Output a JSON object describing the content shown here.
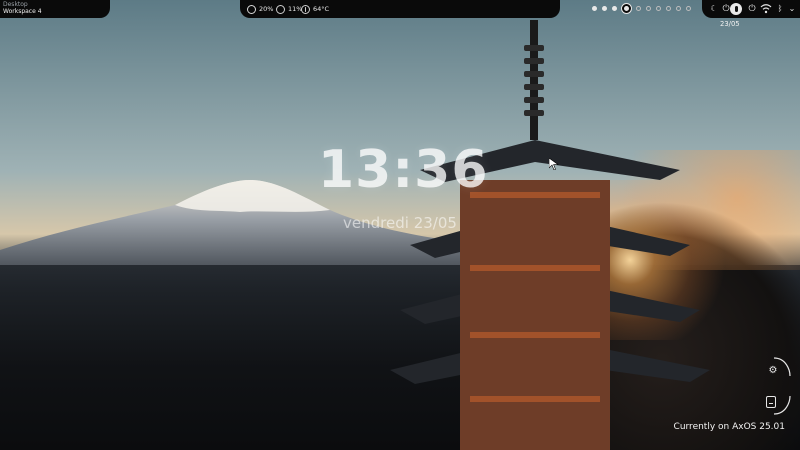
{
  "workspace_panel": {
    "label_top": "Desktop",
    "label_bottom": "Workspace 4"
  },
  "status": {
    "cpu": "20%",
    "memory": "11%",
    "temperature": "64°C"
  },
  "workspaces": {
    "count": 10,
    "active_index": 3,
    "filled_indices": [
      0,
      1,
      2
    ]
  },
  "topbar_clock": "13:36 • vendredi 23/05",
  "tray_icons": [
    "moon-icon",
    "power-icon",
    "toggle-icon",
    "power-button-icon",
    "wifi-icon",
    "bluetooth-icon",
    "chevron-down-icon"
  ],
  "desktop_clock": {
    "time": "13:36",
    "date": "vendredi 23/05"
  },
  "side_controls": [
    "gear-icon",
    "document-icon"
  ],
  "os_label": "Currently on AxOS 25.01",
  "colors": {
    "bar_bg": "#0a0a0a",
    "text": "#f1f1f1",
    "accent_sun": "#ffb35a"
  }
}
